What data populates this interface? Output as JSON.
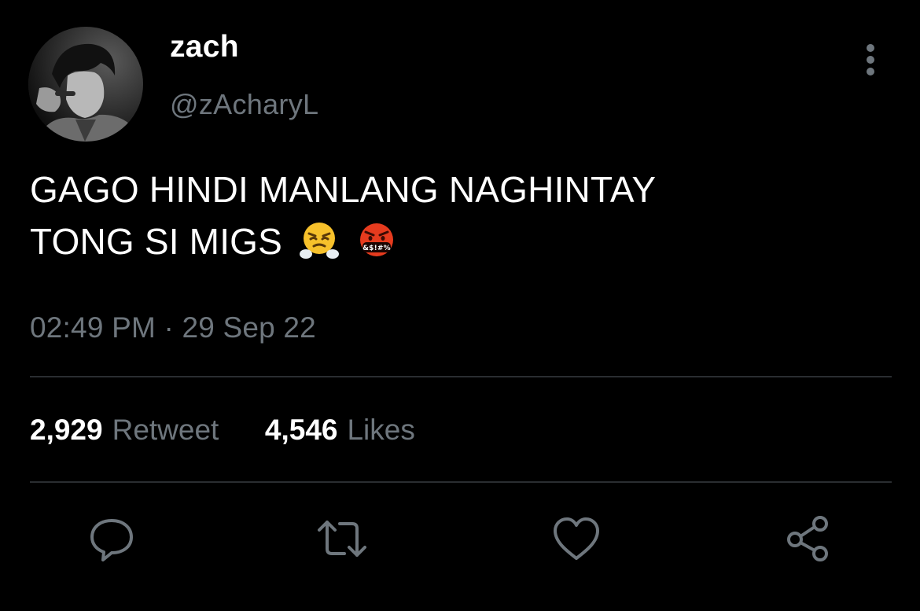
{
  "tweet": {
    "author": {
      "display_name": "zach",
      "handle": "@zAcharyL",
      "avatar": "profile-photo"
    },
    "text_line1": "GAGO HINDI MANLANG NAGHINTAY",
    "text_line2": "TONG SI MIGS",
    "emojis": [
      "face-with-steam-from-nose",
      "face-with-symbols-on-mouth"
    ],
    "timestamp": "02:49 PM · 29 Sep 22",
    "stats": {
      "retweets_count": "2,929",
      "retweets_label": "Retweet",
      "likes_count": "4,546",
      "likes_label": "Likes"
    },
    "actions": [
      "reply-icon",
      "retweet-icon",
      "like-icon",
      "share-icon"
    ]
  },
  "colors": {
    "background": "#000000",
    "primary_text": "#ffffff",
    "secondary_text": "#6e767d",
    "divider": "#2a2d31"
  }
}
